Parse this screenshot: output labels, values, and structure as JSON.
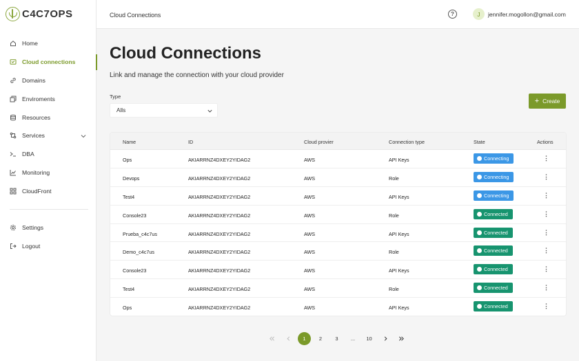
{
  "brand": {
    "logo_text": "C4C7OPS"
  },
  "sidebar": {
    "items": [
      {
        "label": "Home",
        "icon": "home-icon"
      },
      {
        "label": "Cloud connections",
        "icon": "cloud-connections-icon",
        "active": true
      },
      {
        "label": "Domains",
        "icon": "link-icon"
      },
      {
        "label": "Enviroments",
        "icon": "environments-icon"
      },
      {
        "label": "Resources",
        "icon": "database-icon"
      },
      {
        "label": "Services",
        "icon": "services-icon",
        "expandable": true
      },
      {
        "label": "DBA",
        "icon": "terminal-icon"
      },
      {
        "label": "Monitoring",
        "icon": "chart-icon"
      },
      {
        "label": "CloudFront",
        "icon": "cloudfront-icon"
      }
    ],
    "bottom": [
      {
        "label": "Settings",
        "icon": "gear-icon"
      },
      {
        "label": "Logout",
        "icon": "logout-icon"
      }
    ]
  },
  "header": {
    "breadcrumb": "Cloud Connections",
    "avatar_initial": "J",
    "user_email": "jennifer.mogollon@gmail.com"
  },
  "main": {
    "title": "Cloud Connections",
    "subtitle": "Link and manage the connection with your cloud provider",
    "filter": {
      "label": "Type",
      "value": "Alls"
    },
    "create_label": "Create"
  },
  "table": {
    "columns": [
      "Name",
      "ID",
      "Cloud provier",
      "Connection type",
      "State",
      "Actions"
    ],
    "rows": [
      {
        "name": "Ops",
        "id": "AKIARRNZ4DXEY2YIDAG2",
        "provider": "AWS",
        "type": "API Keys",
        "state": "Connecting"
      },
      {
        "name": "Devops",
        "id": "AKIARRNZ4DXEY2YIDAG2",
        "provider": "AWS",
        "type": "Role",
        "state": "Connecting"
      },
      {
        "name": "Test4",
        "id": "AKIARRNZ4DXEY2YIDAG2",
        "provider": "AWS",
        "type": "API Keys",
        "state": "Connecting"
      },
      {
        "name": "Console23",
        "id": "AKIARRNZ4DXEY2YIDAG2",
        "provider": "AWS",
        "type": "Role",
        "state": "Connected"
      },
      {
        "name": "Prueba_c4c7us",
        "id": "AKIARRNZ4DXEY2YIDAG2",
        "provider": "AWS",
        "type": "API Keys",
        "state": "Connected"
      },
      {
        "name": "Demo_c4c7us",
        "id": "AKIARRNZ4DXEY2YIDAG2",
        "provider": "AWS",
        "type": "Role",
        "state": "Connected"
      },
      {
        "name": "Console23",
        "id": "AKIARRNZ4DXEY2YIDAG2",
        "provider": "AWS",
        "type": "API Keys",
        "state": "Connected"
      },
      {
        "name": "Test4",
        "id": "AKIARRNZ4DXEY2YIDAG2",
        "provider": "AWS",
        "type": "Role",
        "state": "Connected"
      },
      {
        "name": "Ops",
        "id": "AKIARRNZ4DXEY2YIDAG2",
        "provider": "AWS",
        "type": "API Keys",
        "state": "Connected"
      }
    ]
  },
  "pagination": {
    "pages": [
      "1",
      "2",
      "3",
      "...",
      "10"
    ],
    "current": "1"
  },
  "colors": {
    "accent": "#7b9a2a",
    "connecting": "#3b97e6",
    "connected": "#17946f"
  }
}
